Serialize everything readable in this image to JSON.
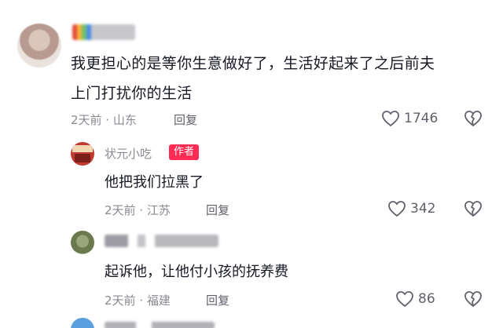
{
  "comments": [
    {
      "text_line1": "我更担心的是等你生意做好了，生活好起来了之后前夫",
      "text_line2": "上门打扰你的生活",
      "meta": "2天前 · 山东",
      "reply_label": "回复",
      "likes": "1746"
    }
  ],
  "replies": [
    {
      "author": "状元小吃",
      "badge": "作者",
      "text": "他把我们拉黑了",
      "meta": "2天前 · 江苏",
      "reply_label": "回复",
      "likes": "342"
    },
    {
      "text": "起诉他，让他付小孩的抚养费",
      "meta": "2天前 · 福建",
      "reply_label": "回复",
      "likes": "86"
    }
  ],
  "icons": {
    "like": "heart-outline-icon",
    "dislike": "broken-heart-icon"
  },
  "colors": {
    "text": "#161823",
    "meta": "#8a8b91",
    "badge": "#fe2c55"
  }
}
